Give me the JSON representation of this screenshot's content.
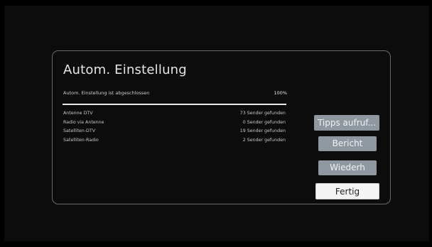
{
  "dialog": {
    "title": "Autom. Einstellung",
    "status_text": "Autom. Einstellung ist abgeschlossen",
    "progress_label": "100%",
    "progress": 1.0,
    "results": [
      {
        "label": "Antenne DTV",
        "value": "73 Sender gefunden"
      },
      {
        "label": "Radio via Antenne",
        "value": "0 Sender gefunden"
      },
      {
        "label": "Satelliten-DTV",
        "value": "19 Sender gefunden"
      },
      {
        "label": "Satelliten-Radio",
        "value": "2 Sender gefunden"
      }
    ]
  },
  "buttons": {
    "tipps": "Tipps aufruf...",
    "bericht": "Bericht",
    "wiederh": "Wiederh",
    "fertig": "Fertig"
  },
  "colors": {
    "button_bg": "#8f97a0",
    "focused_button_bg": "#f4f4f4",
    "progress_fill": "#eaeaea"
  }
}
